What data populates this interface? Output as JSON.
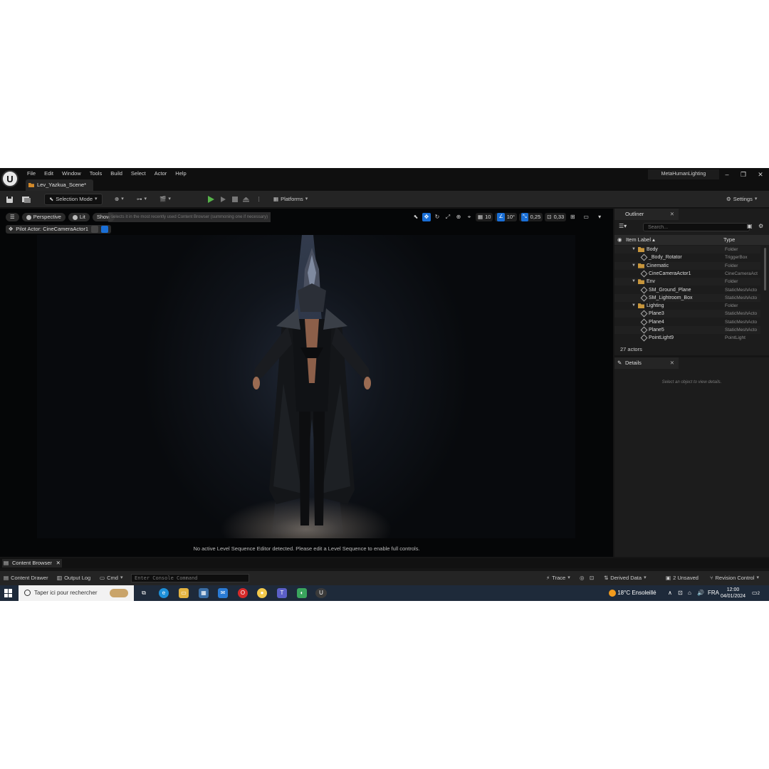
{
  "app": {
    "logo": "ue-logo",
    "menu": [
      "File",
      "Edit",
      "Window",
      "Tools",
      "Build",
      "Select",
      "Actor",
      "Help"
    ],
    "level_tab": "Lev_Yazkua_Scene*",
    "project_name": "MetaHumanLighting",
    "window_buttons": [
      "–",
      "❐",
      "✕"
    ]
  },
  "toolbar": {
    "selection_mode": "Selection Mode",
    "platforms": "Platforms",
    "settings": "Settings"
  },
  "viewport": {
    "perspective": "Perspective",
    "lit": "Lit",
    "show": "Show",
    "hint": "selects it in the most recently used Content Browser (summoning one if necessary)",
    "pilot_actor": "Pilot Actor: CineCameraActor1",
    "grid_snap": "10",
    "rotation_snap": "10°",
    "scale_snap": "0,25",
    "camera_speed": "0,33",
    "sequence_message": "No active Level Sequence Editor detected. Please edit a Level Sequence to enable full controls."
  },
  "outliner": {
    "tab": "Outliner",
    "search_placeholder": "Search...",
    "col_label": "Item Label ▴",
    "col_type": "Type",
    "rows": [
      {
        "label": "Body",
        "type": "Folder",
        "kind": "folder",
        "depth": 1
      },
      {
        "label": "_Body_Rotator",
        "type": "TriggerBox",
        "kind": "item",
        "depth": 2
      },
      {
        "label": "Cinematic",
        "type": "Folder",
        "kind": "folder",
        "depth": 1
      },
      {
        "label": "CineCameraActor1",
        "type": "CineCameraAct",
        "kind": "item",
        "depth": 2
      },
      {
        "label": "Env",
        "type": "Folder",
        "kind": "folder",
        "depth": 1
      },
      {
        "label": "SM_Ground_Plane",
        "type": "StaticMeshActo",
        "kind": "item",
        "depth": 2
      },
      {
        "label": "SM_Lightroom_Box",
        "type": "StaticMeshActo",
        "kind": "item",
        "depth": 2
      },
      {
        "label": "Lighting",
        "type": "Folder",
        "kind": "folder",
        "depth": 1
      },
      {
        "label": "Plane3",
        "type": "StaticMeshActo",
        "kind": "item",
        "depth": 2
      },
      {
        "label": "Plane4",
        "type": "StaticMeshActo",
        "kind": "item",
        "depth": 2
      },
      {
        "label": "Plane5",
        "type": "StaticMeshActo",
        "kind": "item",
        "depth": 2
      },
      {
        "label": "PointLight9",
        "type": "PointLight",
        "kind": "item",
        "depth": 2
      }
    ],
    "actors_count": "27 actors"
  },
  "details": {
    "tab": "Details",
    "message": "Select an object to view details."
  },
  "bottom": {
    "content_browser_tab": "Content Browser",
    "content_drawer": "Content Drawer",
    "output_log": "Output Log",
    "cmd": "Cmd",
    "console_placeholder": "Enter Console Command",
    "trace": "Trace",
    "derived_data": "Derived Data",
    "unsaved": "2 Unsaved",
    "revision_control": "Revision Control"
  },
  "taskbar": {
    "search_placeholder": "Taper ici pour rechercher",
    "weather_temp": "18°C",
    "weather_text": "Ensoleillé",
    "language": "FRA",
    "time": "12:00",
    "date": "04/01/2024",
    "notification_count": "2"
  },
  "colors": {
    "accent_blue": "#1a6fd6",
    "play_green": "#56b34a",
    "folder": "#c8963c"
  }
}
